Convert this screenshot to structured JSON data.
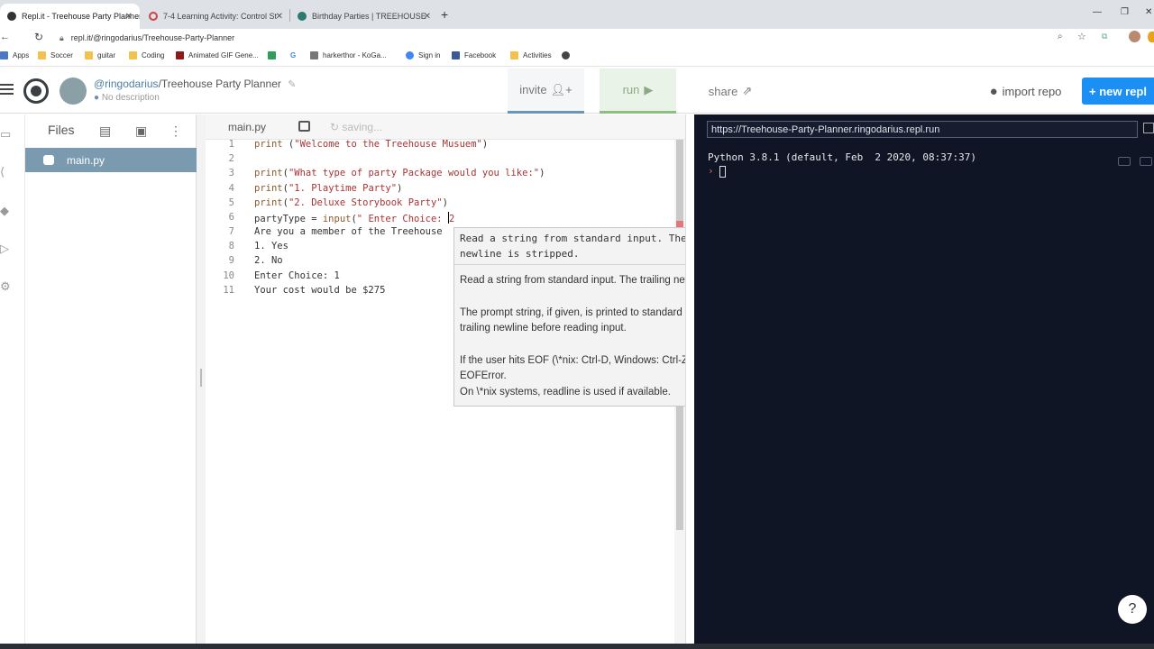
{
  "browser": {
    "tabs": [
      {
        "label": "Repl.it - Treehouse Party Planner",
        "active": true
      },
      {
        "label": "7-4 Learning Activity: Control St"
      },
      {
        "label": "Birthday Parties | TREEHOUSE"
      }
    ],
    "new_tab": "+",
    "address": "repl.it/@ringodarius/Treehouse-Party-Planner",
    "bookmarks": [
      "Apps",
      "Soccer",
      "guitar",
      "Coding",
      "Animated GIF Gene...",
      "G",
      "harkerthor - KoGa...",
      "Sign in",
      "Facebook",
      "Activities"
    ]
  },
  "repl": {
    "user": "@ringodarius",
    "project": "/Treehouse Party Planner",
    "description": "No description",
    "invite": "invite",
    "run": "run",
    "share": "share",
    "import": "import repo",
    "new_repl": "+ new repl"
  },
  "files": {
    "title": "Files",
    "active_file": "main.py"
  },
  "editor": {
    "tab": "main.py",
    "status": "saving...",
    "lines": [
      {
        "n": "1",
        "text": "print (\"Welcome to the Treehouse Musuem\")"
      },
      {
        "n": "2",
        "text": ""
      },
      {
        "n": "3",
        "text": "print(\"What type of party Package would you like:\")"
      },
      {
        "n": "4",
        "text": "print(\"1. Playtime Party\")"
      },
      {
        "n": "5",
        "text": "print(\"2. Deluxe Storybook Party\")"
      },
      {
        "n": "6",
        "text": "partyType = input(\" Enter Choice: 2"
      },
      {
        "n": "7",
        "text": "Are you a member of the Treehouse"
      },
      {
        "n": "8",
        "text": "1. Yes"
      },
      {
        "n": "9",
        "text": "2. No"
      },
      {
        "n": "10",
        "text": "Enter Choice: 1"
      },
      {
        "n": "11",
        "text": "Your cost would be $275"
      }
    ]
  },
  "tooltip": {
    "signature": "Read a string from standard input. The trailing newline is stripped.",
    "p1": "Read a string from standard input.  The trailing newline is stripped.",
    "p2": "The prompt string, if given, is printed to standard output without a trailing newline before reading input.",
    "p3": "If the user hits EOF (\\*nix: Ctrl-D, Windows: Ctrl-Z+Return), raise EOFError.",
    "p4": "On \\*nix systems, readline is used if available."
  },
  "console": {
    "url": "https://Treehouse-Party-Planner.ringodarius.repl.run",
    "version": "Python 3.8.1 (default, Feb  2 2020, 08:37:37)",
    "prompt": "›"
  },
  "help": "?"
}
